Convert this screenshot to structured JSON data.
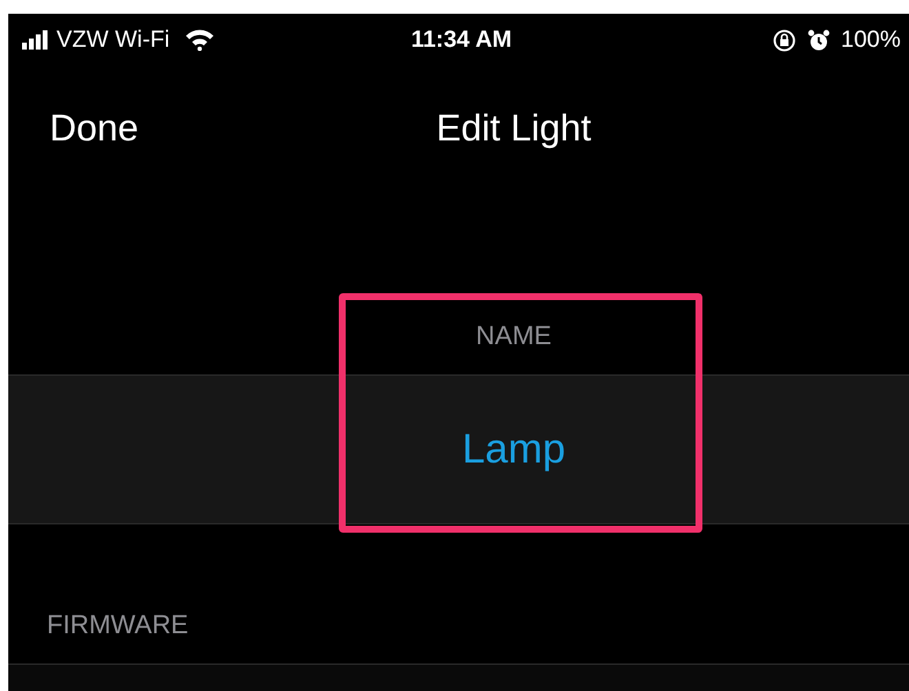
{
  "status_bar": {
    "carrier": "VZW Wi-Fi",
    "time": "11:34 AM",
    "battery": "100%"
  },
  "nav": {
    "left_button": "Done",
    "title": "Edit Light"
  },
  "sections": [
    {
      "header": "NAME",
      "value": "Lamp",
      "highlighted": true
    },
    {
      "header": "FIRMWARE"
    }
  ]
}
